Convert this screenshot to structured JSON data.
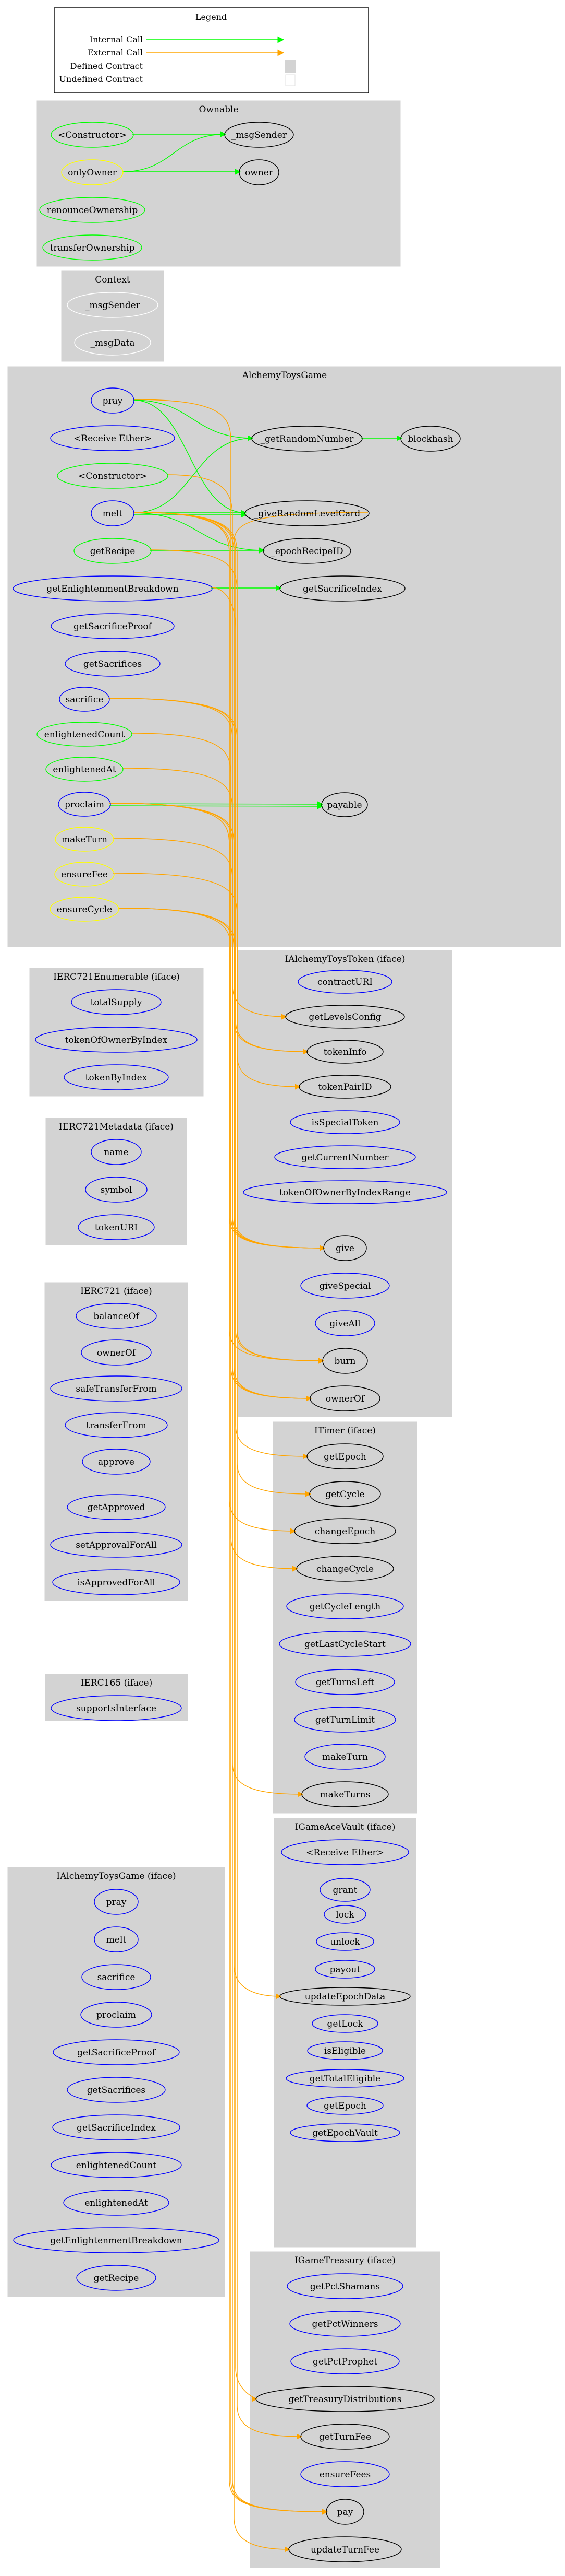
{
  "legend": {
    "title": "Legend",
    "items": [
      {
        "label": "Internal Call",
        "kind": "internal-call"
      },
      {
        "label": "External Call",
        "kind": "external-call"
      },
      {
        "label": "Defined Contract",
        "kind": "defined-contract"
      },
      {
        "label": "Undefined Contract",
        "kind": "undefined-contract"
      }
    ]
  },
  "colors": {
    "internal_call": "#00ff00",
    "external_call": "#ffa500",
    "defined_contract": "#d3d3d3",
    "undefined_contract_border": "#e0e0e0",
    "public_function": "#0000ff",
    "internal_function": "#00ff00",
    "modifier": "#ffff00",
    "external_reference": "#000000",
    "undefined_node": "#ffffff"
  },
  "clusters": [
    {
      "id": "Ownable",
      "title": "Ownable",
      "nodes": [
        {
          "id": "Ownable.ctor",
          "label": "<Constructor>",
          "kind": "internal"
        },
        {
          "id": "Ownable._msgSender",
          "label": "_msgSender",
          "kind": "external"
        },
        {
          "id": "Ownable.onlyOwner",
          "label": "onlyOwner",
          "kind": "modifier"
        },
        {
          "id": "Ownable.owner",
          "label": "owner",
          "kind": "external"
        },
        {
          "id": "Ownable.renounceOwnership",
          "label": "renounceOwnership",
          "kind": "internal"
        },
        {
          "id": "Ownable.transferOwnership",
          "label": "transferOwnership",
          "kind": "internal"
        }
      ]
    },
    {
      "id": "Context",
      "title": "Context",
      "nodes": [
        {
          "id": "Context._msgSender",
          "label": "_msgSender",
          "kind": "undefined"
        },
        {
          "id": "Context._msgData",
          "label": "_msgData",
          "kind": "undefined"
        }
      ]
    },
    {
      "id": "AlchemyToysGame",
      "title": "AlchemyToysGame",
      "nodes": [
        {
          "id": "ATG.pray",
          "label": "pray",
          "kind": "public"
        },
        {
          "id": "ATG.receive",
          "label": "<Receive Ether>",
          "kind": "public"
        },
        {
          "id": "ATG.ctor",
          "label": "<Constructor>",
          "kind": "internal"
        },
        {
          "id": "ATG.melt",
          "label": "melt",
          "kind": "public"
        },
        {
          "id": "ATG.getRecipe",
          "label": "getRecipe",
          "kind": "internal"
        },
        {
          "id": "ATG.getEnlightenmentBreakdown",
          "label": "getEnlightenmentBreakdown",
          "kind": "public"
        },
        {
          "id": "ATG.getSacrificeProof",
          "label": "getSacrificeProof",
          "kind": "public"
        },
        {
          "id": "ATG.getSacrifices",
          "label": "getSacrifices",
          "kind": "public"
        },
        {
          "id": "ATG.sacrifice",
          "label": "sacrifice",
          "kind": "public"
        },
        {
          "id": "ATG.enlightenedCount",
          "label": "enlightenedCount",
          "kind": "internal"
        },
        {
          "id": "ATG.enlightenedAt",
          "label": "enlightenedAt",
          "kind": "internal"
        },
        {
          "id": "ATG.proclaim",
          "label": "proclaim",
          "kind": "public"
        },
        {
          "id": "ATG.makeTurn",
          "label": "makeTurn",
          "kind": "modifier"
        },
        {
          "id": "ATG.ensureFee",
          "label": "ensureFee",
          "kind": "modifier"
        },
        {
          "id": "ATG.ensureCycle",
          "label": "ensureCycle",
          "kind": "modifier"
        },
        {
          "id": "ATG._getRandomNumber",
          "label": "_getRandomNumber",
          "kind": "external"
        },
        {
          "id": "ATG.blockhash",
          "label": "blockhash",
          "kind": "external"
        },
        {
          "id": "ATG._giveRandomLevelCard",
          "label": "_giveRandomLevelCard",
          "kind": "external"
        },
        {
          "id": "ATG._epochRecipeID",
          "label": "_epochRecipeID",
          "kind": "external"
        },
        {
          "id": "ATG.getSacrificeIndex",
          "label": "getSacrificeIndex",
          "kind": "external"
        },
        {
          "id": "ATG.payable",
          "label": "payable",
          "kind": "external"
        }
      ]
    },
    {
      "id": "IERC721Enumerable",
      "title": "IERC721Enumerable  (iface)",
      "nodes": [
        {
          "id": "E.totalSupply",
          "label": "totalSupply",
          "kind": "public"
        },
        {
          "id": "E.tokenOfOwnerByIndex",
          "label": "tokenOfOwnerByIndex",
          "kind": "public"
        },
        {
          "id": "E.tokenByIndex",
          "label": "tokenByIndex",
          "kind": "public"
        }
      ]
    },
    {
      "id": "IERC721Metadata",
      "title": "IERC721Metadata  (iface)",
      "nodes": [
        {
          "id": "M.name",
          "label": "name",
          "kind": "public"
        },
        {
          "id": "M.symbol",
          "label": "symbol",
          "kind": "public"
        },
        {
          "id": "M.tokenURI",
          "label": "tokenURI",
          "kind": "public"
        }
      ]
    },
    {
      "id": "IERC721",
      "title": "IERC721  (iface)",
      "nodes": [
        {
          "id": "I721.balanceOf",
          "label": "balanceOf",
          "kind": "public"
        },
        {
          "id": "I721.ownerOf",
          "label": "ownerOf",
          "kind": "public"
        },
        {
          "id": "I721.safeTransferFrom",
          "label": "safeTransferFrom",
          "kind": "public"
        },
        {
          "id": "I721.transferFrom",
          "label": "transferFrom",
          "kind": "public"
        },
        {
          "id": "I721.approve",
          "label": "approve",
          "kind": "public"
        },
        {
          "id": "I721.getApproved",
          "label": "getApproved",
          "kind": "public"
        },
        {
          "id": "I721.setApprovalForAll",
          "label": "setApprovalForAll",
          "kind": "public"
        },
        {
          "id": "I721.isApprovedForAll",
          "label": "isApprovedForAll",
          "kind": "public"
        }
      ]
    },
    {
      "id": "IERC165",
      "title": "IERC165  (iface)",
      "nodes": [
        {
          "id": "I165.supportsInterface",
          "label": "supportsInterface",
          "kind": "public"
        }
      ]
    },
    {
      "id": "IAlchemyToysGame",
      "title": "IAlchemyToysGame  (iface)",
      "nodes": [
        {
          "id": "IATG.pray",
          "label": "pray",
          "kind": "public"
        },
        {
          "id": "IATG.melt",
          "label": "melt",
          "kind": "public"
        },
        {
          "id": "IATG.sacrifice",
          "label": "sacrifice",
          "kind": "public"
        },
        {
          "id": "IATG.proclaim",
          "label": "proclaim",
          "kind": "public"
        },
        {
          "id": "IATG.getSacrificeProof",
          "label": "getSacrificeProof",
          "kind": "public"
        },
        {
          "id": "IATG.getSacrifices",
          "label": "getSacrifices",
          "kind": "public"
        },
        {
          "id": "IATG.getSacrificeIndex",
          "label": "getSacrificeIndex",
          "kind": "public"
        },
        {
          "id": "IATG.enlightenedCount",
          "label": "enlightenedCount",
          "kind": "public"
        },
        {
          "id": "IATG.enlightenedAt",
          "label": "enlightenedAt",
          "kind": "public"
        },
        {
          "id": "IATG.getEnlightenmentBreakdown",
          "label": "getEnlightenmentBreakdown",
          "kind": "public"
        },
        {
          "id": "IATG.getRecipe",
          "label": "getRecipe",
          "kind": "public"
        }
      ]
    },
    {
      "id": "IAlchemyToysToken",
      "title": "IAlchemyToysToken  (iface)",
      "nodes": [
        {
          "id": "T.contractURI",
          "label": "contractURI",
          "kind": "public"
        },
        {
          "id": "T.getLevelsConfig",
          "label": "getLevelsConfig",
          "kind": "external"
        },
        {
          "id": "T.tokenInfo",
          "label": "tokenInfo",
          "kind": "external"
        },
        {
          "id": "T.tokenPairID",
          "label": "tokenPairID",
          "kind": "external"
        },
        {
          "id": "T.isSpecialToken",
          "label": "isSpecialToken",
          "kind": "public"
        },
        {
          "id": "T.getCurrentNumber",
          "label": "getCurrentNumber",
          "kind": "public"
        },
        {
          "id": "T.tokenOfOwnerByIndexRange",
          "label": "tokenOfOwnerByIndexRange",
          "kind": "public"
        },
        {
          "id": "T.give",
          "label": "give",
          "kind": "external"
        },
        {
          "id": "T.giveSpecial",
          "label": "giveSpecial",
          "kind": "public"
        },
        {
          "id": "T.giveAll",
          "label": "giveAll",
          "kind": "public"
        },
        {
          "id": "T.burn",
          "label": "burn",
          "kind": "external"
        },
        {
          "id": "T.ownerOf",
          "label": "ownerOf",
          "kind": "external"
        }
      ]
    },
    {
      "id": "ITimer",
      "title": "ITimer  (iface)",
      "nodes": [
        {
          "id": "Tm.getEpoch",
          "label": "getEpoch",
          "kind": "external"
        },
        {
          "id": "Tm.getCycle",
          "label": "getCycle",
          "kind": "external"
        },
        {
          "id": "Tm.changeEpoch",
          "label": "changeEpoch",
          "kind": "external"
        },
        {
          "id": "Tm.changeCycle",
          "label": "changeCycle",
          "kind": "external"
        },
        {
          "id": "Tm.getCycleLength",
          "label": "getCycleLength",
          "kind": "public"
        },
        {
          "id": "Tm.getLastCycleStart",
          "label": "getLastCycleStart",
          "kind": "public"
        },
        {
          "id": "Tm.getTurnsLeft",
          "label": "getTurnsLeft",
          "kind": "public"
        },
        {
          "id": "Tm.getTurnLimit",
          "label": "getTurnLimit",
          "kind": "public"
        },
        {
          "id": "Tm.makeTurn",
          "label": "makeTurn",
          "kind": "public"
        },
        {
          "id": "Tm.makeTurns",
          "label": "makeTurns",
          "kind": "external"
        }
      ]
    },
    {
      "id": "IGameAceVault",
      "title": "IGameAceVault  (iface)",
      "nodes": [
        {
          "id": "V.receive",
          "label": "<Receive Ether>",
          "kind": "public"
        },
        {
          "id": "V.grant",
          "label": "grant",
          "kind": "public"
        },
        {
          "id": "V.lock",
          "label": "lock",
          "kind": "public"
        },
        {
          "id": "V.unlock",
          "label": "unlock",
          "kind": "public"
        },
        {
          "id": "V.payout",
          "label": "payout",
          "kind": "public"
        },
        {
          "id": "V.updateEpochData",
          "label": "updateEpochData",
          "kind": "external"
        },
        {
          "id": "V.getLock",
          "label": "getLock",
          "kind": "public"
        },
        {
          "id": "V.isEligible",
          "label": "isEligible",
          "kind": "public"
        },
        {
          "id": "V.getTotalEligible",
          "label": "getTotalEligible",
          "kind": "public"
        },
        {
          "id": "V.getEpoch",
          "label": "getEpoch",
          "kind": "public"
        },
        {
          "id": "V.getEpochVault",
          "label": "getEpochVault",
          "kind": "public"
        }
      ]
    },
    {
      "id": "IGameTreasury",
      "title": "IGameTreasury  (iface)",
      "nodes": [
        {
          "id": "Tr.getPctShamans",
          "label": "getPctShamans",
          "kind": "public"
        },
        {
          "id": "Tr.getPctWinners",
          "label": "getPctWinners",
          "kind": "public"
        },
        {
          "id": "Tr.getPctProphet",
          "label": "getPctProphet",
          "kind": "public"
        },
        {
          "id": "Tr.getTreasuryDistributions",
          "label": "getTreasuryDistributions",
          "kind": "external"
        },
        {
          "id": "Tr.getTurnFee",
          "label": "getTurnFee",
          "kind": "external"
        },
        {
          "id": "Tr.ensureFees",
          "label": "ensureFees",
          "kind": "public"
        },
        {
          "id": "Tr.pay",
          "label": "pay",
          "kind": "external"
        },
        {
          "id": "Tr.updateTurnFee",
          "label": "updateTurnFee",
          "kind": "external"
        }
      ]
    }
  ],
  "edges": [
    {
      "from": "Ownable.ctor",
      "to": "Ownable._msgSender",
      "type": "internal"
    },
    {
      "from": "Ownable.onlyOwner",
      "to": "Ownable._msgSender",
      "type": "internal"
    },
    {
      "from": "Ownable.onlyOwner",
      "to": "Ownable.owner",
      "type": "internal"
    },
    {
      "from": "ATG.pray",
      "to": "ATG._getRandomNumber",
      "type": "internal"
    },
    {
      "from": "ATG.pray",
      "to": "ATG._giveRandomLevelCard",
      "type": "internal"
    },
    {
      "from": "ATG._getRandomNumber",
      "to": "ATG.blockhash",
      "type": "internal"
    },
    {
      "from": "ATG.melt",
      "to": "ATG._getRandomNumber",
      "type": "internal"
    },
    {
      "from": "ATG.melt",
      "to": "ATG._giveRandomLevelCard",
      "type": "internal"
    },
    {
      "from": "ATG.melt",
      "to": "ATG._giveRandomLevelCard",
      "type": "internal"
    },
    {
      "from": "ATG.melt",
      "to": "ATG._epochRecipeID",
      "type": "internal"
    },
    {
      "from": "ATG.getRecipe",
      "to": "ATG._epochRecipeID",
      "type": "internal"
    },
    {
      "from": "ATG.getEnlightenmentBreakdown",
      "to": "ATG.getSacrificeIndex",
      "type": "internal"
    },
    {
      "from": "ATG.proclaim",
      "to": "ATG.payable",
      "type": "internal"
    },
    {
      "from": "ATG.proclaim",
      "to": "ATG.payable",
      "type": "internal"
    },
    {
      "from": "ATG.ctor",
      "to": "T.getLevelsConfig",
      "type": "external"
    },
    {
      "from": "ATG.melt",
      "to": "T.tokenInfo",
      "type": "external"
    },
    {
      "from": "ATG.sacrifice",
      "to": "T.tokenInfo",
      "type": "external"
    },
    {
      "from": "ATG.melt",
      "to": "T.tokenPairID",
      "type": "external"
    },
    {
      "from": "ATG.melt",
      "to": "T.give",
      "type": "external"
    },
    {
      "from": "ATG.pray",
      "to": "T.give",
      "type": "external"
    },
    {
      "from": "ATG.proclaim",
      "to": "T.give",
      "type": "external"
    },
    {
      "from": "ATG._giveRandomLevelCard",
      "to": "T.give",
      "type": "external"
    },
    {
      "from": "ATG.melt",
      "to": "T.burn",
      "type": "external"
    },
    {
      "from": "ATG.sacrifice",
      "to": "T.burn",
      "type": "external"
    },
    {
      "from": "ATG.proclaim",
      "to": "T.burn",
      "type": "external"
    },
    {
      "from": "ATG.melt",
      "to": "T.ownerOf",
      "type": "external"
    },
    {
      "from": "ATG.sacrifice",
      "to": "T.ownerOf",
      "type": "external"
    },
    {
      "from": "ATG.proclaim",
      "to": "T.ownerOf",
      "type": "external"
    },
    {
      "from": "ATG.ensureCycle",
      "to": "Tm.getEpoch",
      "type": "external"
    },
    {
      "from": "ATG.getRecipe",
      "to": "Tm.getCycle",
      "type": "external"
    },
    {
      "from": "ATG.proclaim",
      "to": "Tm.changeEpoch",
      "type": "external"
    },
    {
      "from": "ATG.ensureCycle",
      "to": "Tm.changeCycle",
      "type": "external"
    },
    {
      "from": "ATG.makeTurn",
      "to": "Tm.makeTurns",
      "type": "external"
    },
    {
      "from": "ATG.proclaim",
      "to": "V.updateEpochData",
      "type": "external"
    },
    {
      "from": "ATG.getEnlightenmentBreakdown",
      "to": "Tr.getTreasuryDistributions",
      "type": "external"
    },
    {
      "from": "ATG.ensureFee",
      "to": "Tr.getTurnFee",
      "type": "external"
    },
    {
      "from": "ATG.melt",
      "to": "Tr.pay",
      "type": "external"
    },
    {
      "from": "ATG.enlightenedCount",
      "to": "Tr.pay",
      "type": "external"
    },
    {
      "from": "ATG.enlightenedAt",
      "to": "Tr.pay",
      "type": "external"
    },
    {
      "from": "ATG.ensureCycle",
      "to": "Tr.updateTurnFee",
      "type": "external"
    }
  ]
}
